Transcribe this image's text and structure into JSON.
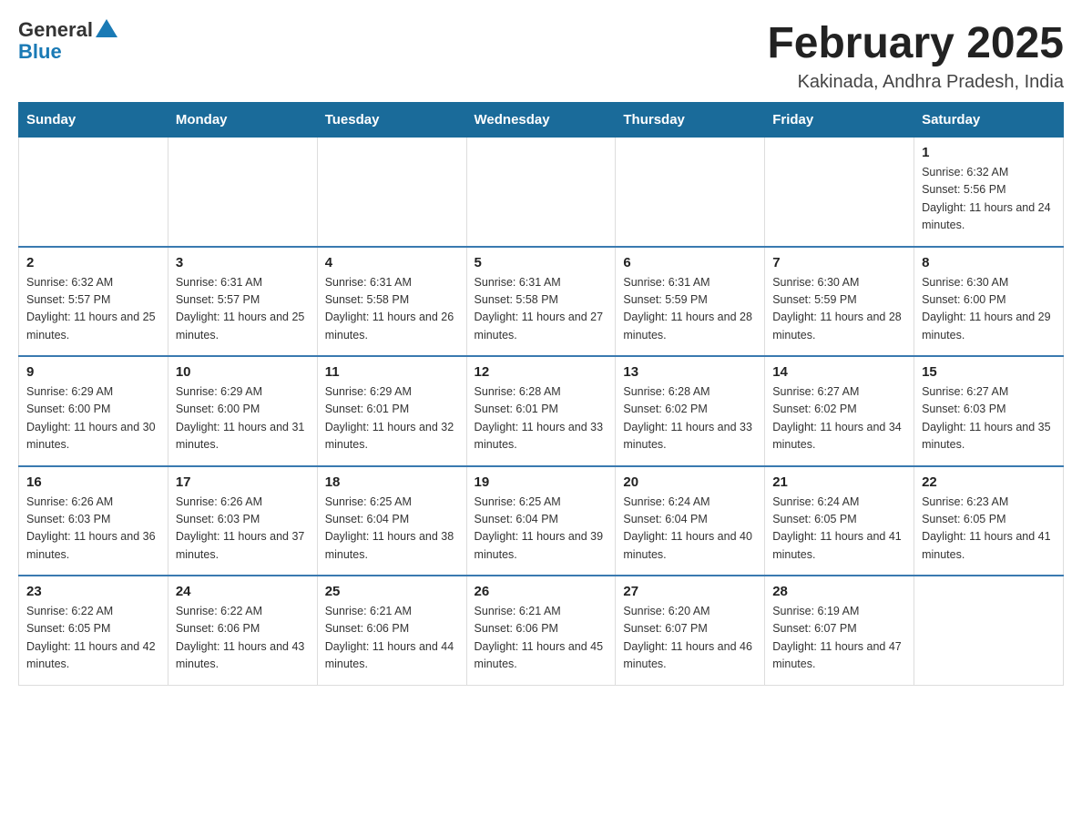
{
  "header": {
    "logo_general": "General",
    "logo_blue": "Blue",
    "title": "February 2025",
    "subtitle": "Kakinada, Andhra Pradesh, India"
  },
  "days_of_week": [
    "Sunday",
    "Monday",
    "Tuesday",
    "Wednesday",
    "Thursday",
    "Friday",
    "Saturday"
  ],
  "weeks": [
    {
      "days": [
        {
          "number": "",
          "info": ""
        },
        {
          "number": "",
          "info": ""
        },
        {
          "number": "",
          "info": ""
        },
        {
          "number": "",
          "info": ""
        },
        {
          "number": "",
          "info": ""
        },
        {
          "number": "",
          "info": ""
        },
        {
          "number": "1",
          "info": "Sunrise: 6:32 AM\nSunset: 5:56 PM\nDaylight: 11 hours and 24 minutes."
        }
      ]
    },
    {
      "days": [
        {
          "number": "2",
          "info": "Sunrise: 6:32 AM\nSunset: 5:57 PM\nDaylight: 11 hours and 25 minutes."
        },
        {
          "number": "3",
          "info": "Sunrise: 6:31 AM\nSunset: 5:57 PM\nDaylight: 11 hours and 25 minutes."
        },
        {
          "number": "4",
          "info": "Sunrise: 6:31 AM\nSunset: 5:58 PM\nDaylight: 11 hours and 26 minutes."
        },
        {
          "number": "5",
          "info": "Sunrise: 6:31 AM\nSunset: 5:58 PM\nDaylight: 11 hours and 27 minutes."
        },
        {
          "number": "6",
          "info": "Sunrise: 6:31 AM\nSunset: 5:59 PM\nDaylight: 11 hours and 28 minutes."
        },
        {
          "number": "7",
          "info": "Sunrise: 6:30 AM\nSunset: 5:59 PM\nDaylight: 11 hours and 28 minutes."
        },
        {
          "number": "8",
          "info": "Sunrise: 6:30 AM\nSunset: 6:00 PM\nDaylight: 11 hours and 29 minutes."
        }
      ]
    },
    {
      "days": [
        {
          "number": "9",
          "info": "Sunrise: 6:29 AM\nSunset: 6:00 PM\nDaylight: 11 hours and 30 minutes."
        },
        {
          "number": "10",
          "info": "Sunrise: 6:29 AM\nSunset: 6:00 PM\nDaylight: 11 hours and 31 minutes."
        },
        {
          "number": "11",
          "info": "Sunrise: 6:29 AM\nSunset: 6:01 PM\nDaylight: 11 hours and 32 minutes."
        },
        {
          "number": "12",
          "info": "Sunrise: 6:28 AM\nSunset: 6:01 PM\nDaylight: 11 hours and 33 minutes."
        },
        {
          "number": "13",
          "info": "Sunrise: 6:28 AM\nSunset: 6:02 PM\nDaylight: 11 hours and 33 minutes."
        },
        {
          "number": "14",
          "info": "Sunrise: 6:27 AM\nSunset: 6:02 PM\nDaylight: 11 hours and 34 minutes."
        },
        {
          "number": "15",
          "info": "Sunrise: 6:27 AM\nSunset: 6:03 PM\nDaylight: 11 hours and 35 minutes."
        }
      ]
    },
    {
      "days": [
        {
          "number": "16",
          "info": "Sunrise: 6:26 AM\nSunset: 6:03 PM\nDaylight: 11 hours and 36 minutes."
        },
        {
          "number": "17",
          "info": "Sunrise: 6:26 AM\nSunset: 6:03 PM\nDaylight: 11 hours and 37 minutes."
        },
        {
          "number": "18",
          "info": "Sunrise: 6:25 AM\nSunset: 6:04 PM\nDaylight: 11 hours and 38 minutes."
        },
        {
          "number": "19",
          "info": "Sunrise: 6:25 AM\nSunset: 6:04 PM\nDaylight: 11 hours and 39 minutes."
        },
        {
          "number": "20",
          "info": "Sunrise: 6:24 AM\nSunset: 6:04 PM\nDaylight: 11 hours and 40 minutes."
        },
        {
          "number": "21",
          "info": "Sunrise: 6:24 AM\nSunset: 6:05 PM\nDaylight: 11 hours and 41 minutes."
        },
        {
          "number": "22",
          "info": "Sunrise: 6:23 AM\nSunset: 6:05 PM\nDaylight: 11 hours and 41 minutes."
        }
      ]
    },
    {
      "days": [
        {
          "number": "23",
          "info": "Sunrise: 6:22 AM\nSunset: 6:05 PM\nDaylight: 11 hours and 42 minutes."
        },
        {
          "number": "24",
          "info": "Sunrise: 6:22 AM\nSunset: 6:06 PM\nDaylight: 11 hours and 43 minutes."
        },
        {
          "number": "25",
          "info": "Sunrise: 6:21 AM\nSunset: 6:06 PM\nDaylight: 11 hours and 44 minutes."
        },
        {
          "number": "26",
          "info": "Sunrise: 6:21 AM\nSunset: 6:06 PM\nDaylight: 11 hours and 45 minutes."
        },
        {
          "number": "27",
          "info": "Sunrise: 6:20 AM\nSunset: 6:07 PM\nDaylight: 11 hours and 46 minutes."
        },
        {
          "number": "28",
          "info": "Sunrise: 6:19 AM\nSunset: 6:07 PM\nDaylight: 11 hours and 47 minutes."
        },
        {
          "number": "",
          "info": ""
        }
      ]
    }
  ]
}
